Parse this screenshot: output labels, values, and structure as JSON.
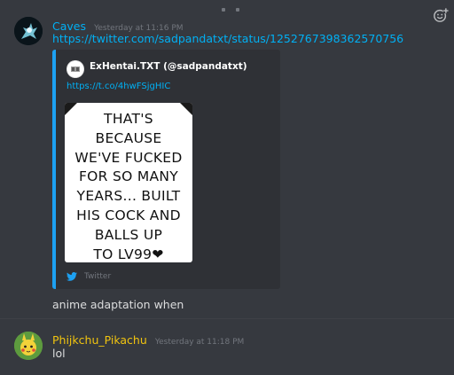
{
  "messages": [
    {
      "username": "Caves",
      "username_color": "#00b0f4",
      "timestamp": "Yesterday at 11:16 PM",
      "lines": [
        "https://twitter.com/sadpandatxt/status/1252767398362570756"
      ],
      "embed": {
        "author": "ExHentai.TXT (@sadpandatxt)",
        "description": "https://t.co/4hwFSjgHIC",
        "image_text": [
          "THAT'S",
          "BECAUSE",
          "WE'VE FUCKED",
          "FOR SO MANY",
          "YEARS... BUILT",
          "HIS COCK AND",
          "BALLS UP",
          "TO LV99❤"
        ],
        "footer": "Twitter",
        "border_color": "#1da1f2"
      },
      "after_embed": "anime adaptation when"
    },
    {
      "username": "Phijkchu_Pikachu",
      "username_color": "#f1c40f",
      "timestamp": "Yesterday at 11:18 PM",
      "lines": [
        "lol"
      ]
    }
  ],
  "icons": {
    "add_reaction": "add-reaction-icon",
    "twitter": "twitter-bird-icon"
  }
}
